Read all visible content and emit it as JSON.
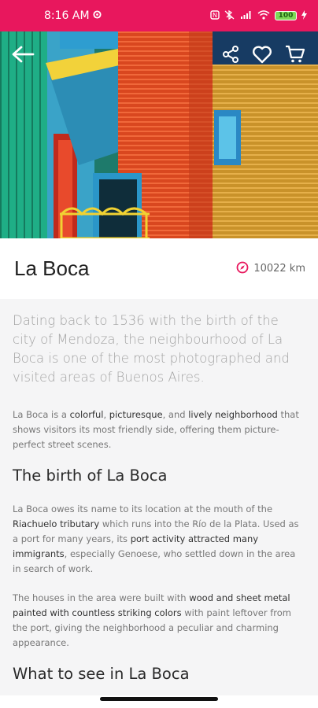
{
  "status_bar": {
    "time": "8:16 AM",
    "battery": "100",
    "colors": {
      "background": "#e8175d"
    },
    "icons": [
      "settings-gear-icon",
      "nfc-icon",
      "bluetooth-muted-icon",
      "signal-icon",
      "wifi-icon",
      "battery-icon",
      "charging-bolt-icon"
    ]
  },
  "header": {
    "back_icon": "arrow-left-icon",
    "actions": [
      "share-icon",
      "heart-icon",
      "cart-icon"
    ]
  },
  "place": {
    "title": "La Boca",
    "distance": "10022 km",
    "distance_icon": "compass-icon",
    "accent_color": "#e8175d"
  },
  "article": {
    "lead": "Dating back to 1536 with the birth of the city of Mendoza, the neighbourhood of La Boca is  one of the most photographed and visited areas of Buenos Aires.",
    "p1": {
      "a": "La Boca is a ",
      "b1": "colorful",
      "c": ", ",
      "b2": "picturesque",
      "d": ", and ",
      "b3": "lively neighborhood",
      "e": " that shows visitors its most friendly side, offering them picture-perfect street scenes."
    },
    "h2_birth": "The birth of La Boca",
    "p2": {
      "a": "La Boca owes its name to its location at the mouth of the ",
      "b1": "Riachuelo tributary",
      "c": " which runs into the Río de la Plata. Used as a port for many years, its ",
      "b2": "port activity attracted many immigrants",
      "d": ", especially Genoese, who settled down in the area in search of work."
    },
    "p3": {
      "a": "The houses in the area were built with ",
      "b1": "wood and sheet metal painted with countless striking colors",
      "c": " with paint leftover from the port, giving the neighborhood a peculiar and charming appearance."
    },
    "h2_see": "What to see in La Boca"
  }
}
